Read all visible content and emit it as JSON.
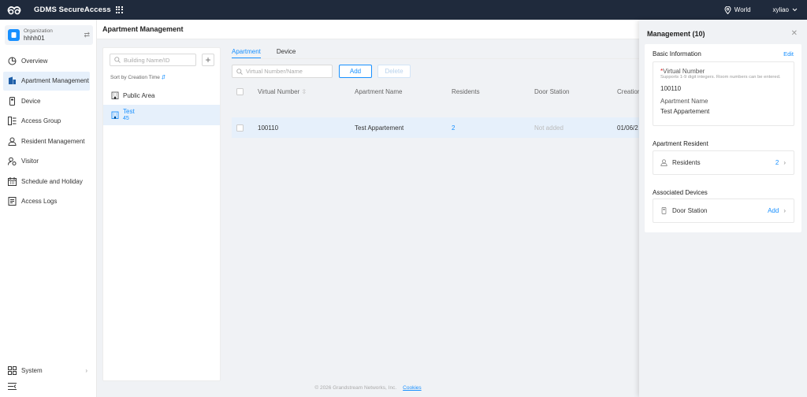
{
  "app": {
    "name": "GDMS SecureAccess",
    "region": "World",
    "user": "xyliao"
  },
  "org": {
    "label": "Organization",
    "name": "hhhh01"
  },
  "nav": {
    "items": [
      {
        "label": "Overview"
      },
      {
        "label": "Apartment Management"
      },
      {
        "label": "Device"
      },
      {
        "label": "Access Group"
      },
      {
        "label": "Resident Management"
      },
      {
        "label": "Visitor"
      },
      {
        "label": "Schedule and Holiday"
      },
      {
        "label": "Access Logs"
      }
    ],
    "system": "System"
  },
  "page": {
    "title": "Apartment Management"
  },
  "buildings": {
    "search_placeholder": "Building Name/ID",
    "sort_label": "Sort by Creation Time",
    "items": [
      {
        "name": "Public Area",
        "sub": ""
      },
      {
        "name": "Test",
        "sub": "45"
      }
    ]
  },
  "tabs": [
    "Apartment",
    "Device"
  ],
  "toolbar": {
    "search_placeholder": "Virtual Number/Name",
    "add": "Add",
    "delete": "Delete"
  },
  "table": {
    "headers": [
      "Virtual Number",
      "Apartment Name",
      "Residents",
      "Door Station",
      "Creation"
    ],
    "rows": [
      {
        "virtual_number": "100110",
        "apartment_name": "Test Appartement",
        "residents": "2",
        "door_station": "Not added",
        "creation": "01/06/2"
      }
    ]
  },
  "footer": {
    "copyright": "© 2026 Grandstream Networks, Inc.",
    "cookies": "Cookies"
  },
  "drawer": {
    "title": "Management (10)",
    "basic_info": "Basic Information",
    "edit": "Edit",
    "virtual_number_label": "Virtual Number",
    "virtual_number_hint": "Supports 1-9 digit integers. Room numbers can be entered.",
    "virtual_number_value": "100110",
    "apartment_name_label": "Apartment Name",
    "apartment_name_value": "Test Appartement",
    "resident_section": "Apartment Resident",
    "residents_label": "Residents",
    "residents_count": "2",
    "devices_section": "Associated Devices",
    "door_station_label": "Door Station",
    "door_station_action": "Add"
  },
  "colors": {
    "accent": "#1890ff",
    "topbar": "#1f2a3c",
    "selected_bg": "#e6f0fb"
  }
}
